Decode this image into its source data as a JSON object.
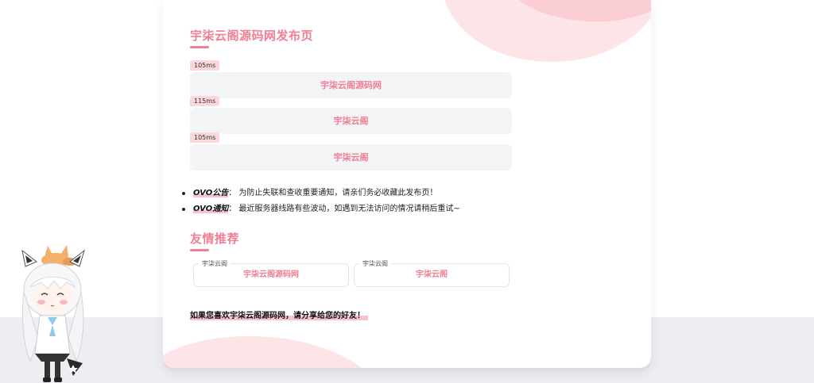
{
  "page": {
    "title": "宇柒云阁源码网发布页"
  },
  "links": [
    {
      "latency": "105ms",
      "label": "宇柒云阁源码网"
    },
    {
      "latency": "115ms",
      "label": "宇柒云阁"
    },
    {
      "latency": "105ms",
      "label": "宇柒云阁"
    }
  ],
  "notices": [
    {
      "tag": "OVO公告",
      "sep": "：",
      "text": "为防止失联和查收重要通知，请亲们务必收藏此发布页！"
    },
    {
      "tag": "OVO通知",
      "sep": "：",
      "text": "最近服务器线路有些波动，如遇到无法访问的情况请稍后重试~"
    }
  ],
  "friends": {
    "title": "友情推荐",
    "items": [
      {
        "legend": "宇柒云阁",
        "name": "宇柒云阁源码网"
      },
      {
        "legend": "宇柒云阁",
        "name": "宇柒云阁"
      }
    ]
  },
  "share_text": "如果您喜欢宇柒云阁源码网，请分享给您的好友！",
  "colors": {
    "accent": "#f07f93",
    "accent_light": "#fbd7dc",
    "button_bg": "#f3f4f6",
    "page_bottom": "#eceef1"
  }
}
